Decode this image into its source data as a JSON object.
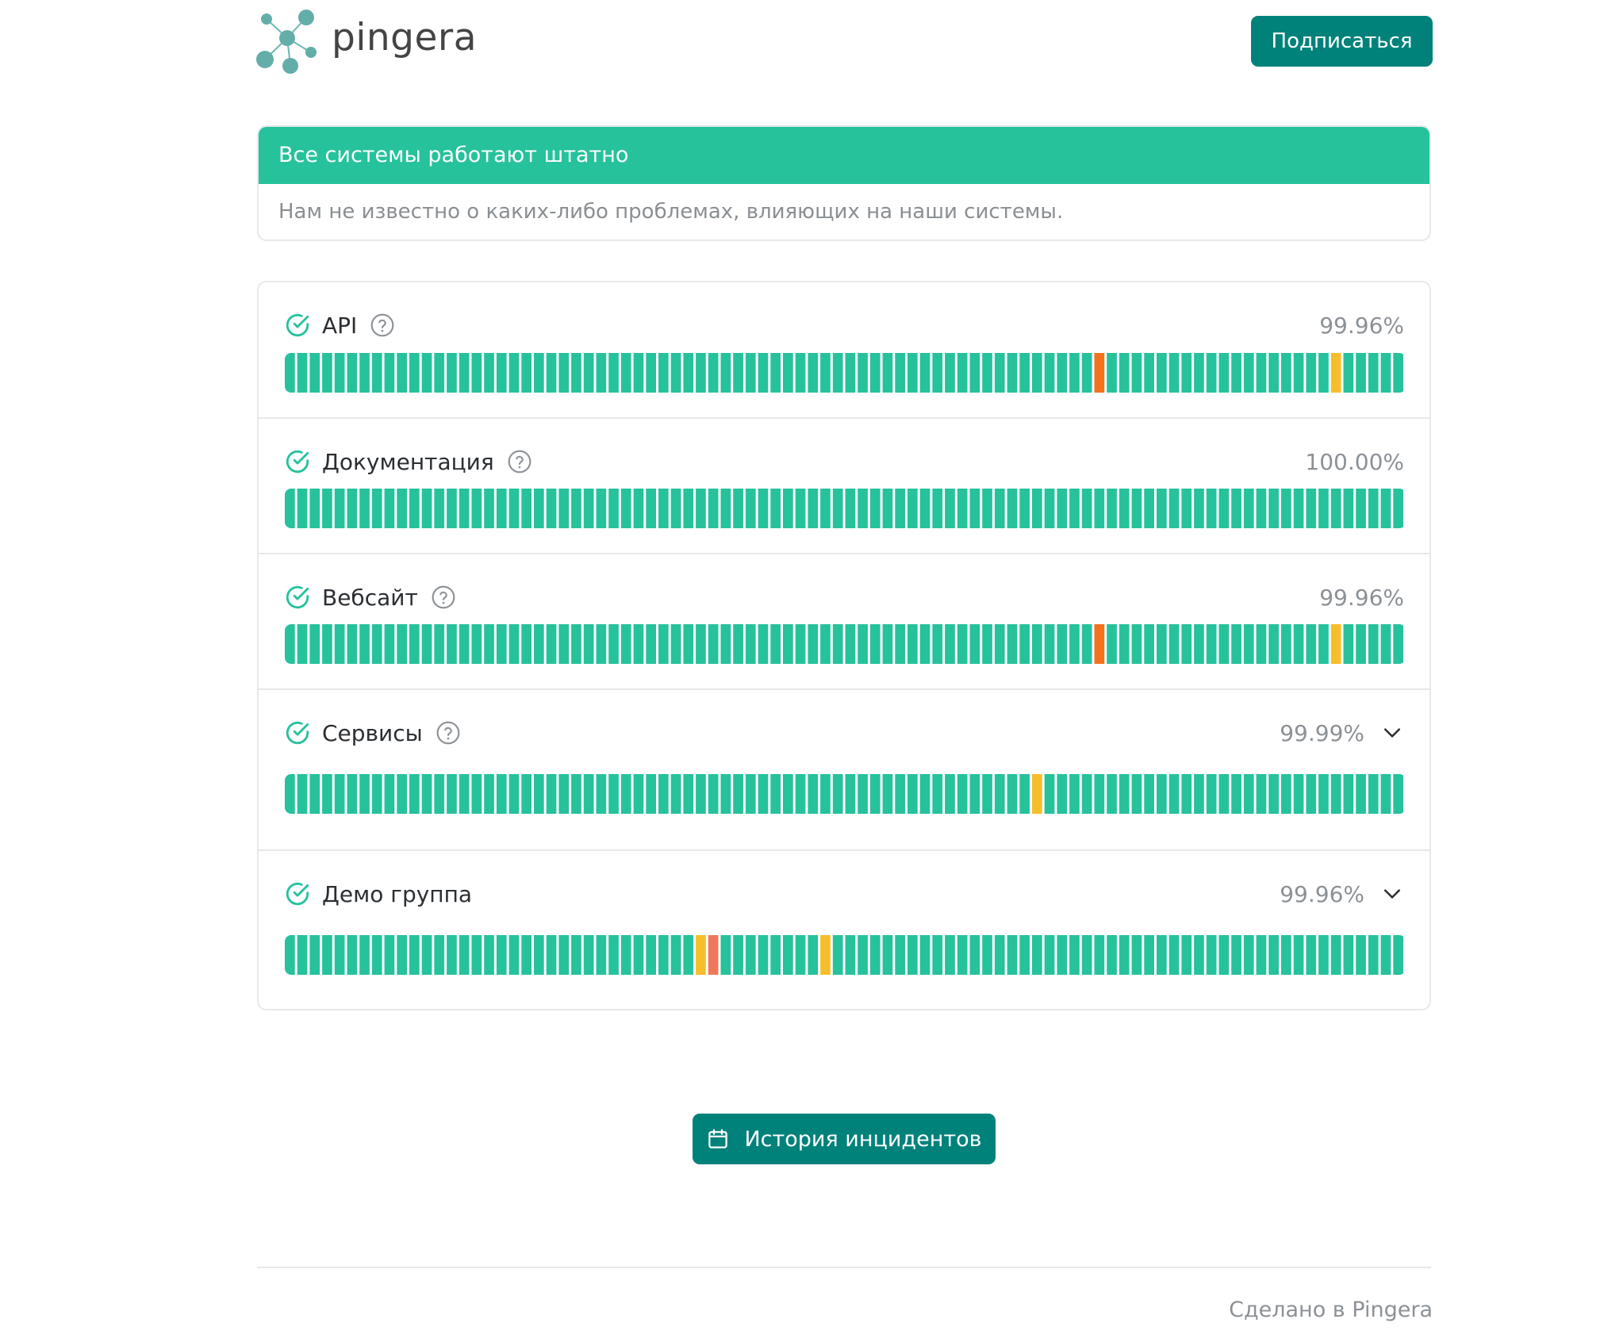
{
  "header": {
    "logo_text": "pingera",
    "subscribe_label": "Подписаться"
  },
  "status": {
    "title": "Все системы работают штатно",
    "description": "Нам не известно о каких-либо проблемах, влияющих на наши системы."
  },
  "colors": {
    "ok": "#26c29b",
    "partial": "#f7be2b",
    "major": "#f4721c",
    "degraded": "#f0785a",
    "accent": "#00827b"
  },
  "components": [
    {
      "name": "API",
      "uptime": "99.96%",
      "has_help": true,
      "expandable": false,
      "incidents": [
        {
          "day": 65,
          "status": "major"
        },
        {
          "day": 84,
          "status": "partial"
        }
      ]
    },
    {
      "name": "Документация",
      "uptime": "100.00%",
      "has_help": true,
      "expandable": false,
      "incidents": []
    },
    {
      "name": "Вебсайт",
      "uptime": "99.96%",
      "has_help": true,
      "expandable": false,
      "incidents": [
        {
          "day": 65,
          "status": "major"
        },
        {
          "day": 84,
          "status": "partial"
        }
      ]
    },
    {
      "name": "Сервисы",
      "uptime": "99.99%",
      "has_help": true,
      "expandable": true,
      "incidents": [
        {
          "day": 60,
          "status": "partial"
        }
      ]
    },
    {
      "name": "Демо группа",
      "uptime": "99.96%",
      "has_help": false,
      "expandable": true,
      "incidents": [
        {
          "day": 33,
          "status": "partial"
        },
        {
          "day": 34,
          "status": "degraded"
        },
        {
          "day": 43,
          "status": "partial"
        }
      ]
    }
  ],
  "history_label": "История инцидентов",
  "footer_text": "Сделано в Pingera"
}
